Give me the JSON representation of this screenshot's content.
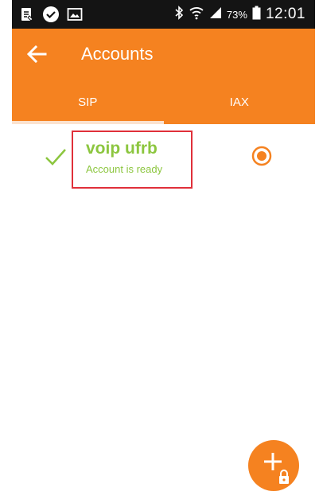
{
  "status_bar": {
    "battery": "73%",
    "time": "12:01"
  },
  "app_bar": {
    "title": "Accounts"
  },
  "tabs": [
    {
      "label": "SIP",
      "selected": true
    },
    {
      "label": "IAX",
      "selected": false
    }
  ],
  "accounts": [
    {
      "name": "voip ufrb",
      "status": "Account is ready",
      "enabled": true,
      "selected": true
    }
  ],
  "colors": {
    "accent": "#f58220",
    "status_ready": "#8cc63f",
    "highlight_box": "#e0303a"
  },
  "icons": [
    "notes-icon",
    "check-circle-icon",
    "image-icon",
    "bluetooth-icon",
    "wifi-icon",
    "signal-icon",
    "battery-icon",
    "back-arrow-icon",
    "checkmark-icon",
    "radio-selected-icon",
    "add-account-icon",
    "lock-icon"
  ]
}
